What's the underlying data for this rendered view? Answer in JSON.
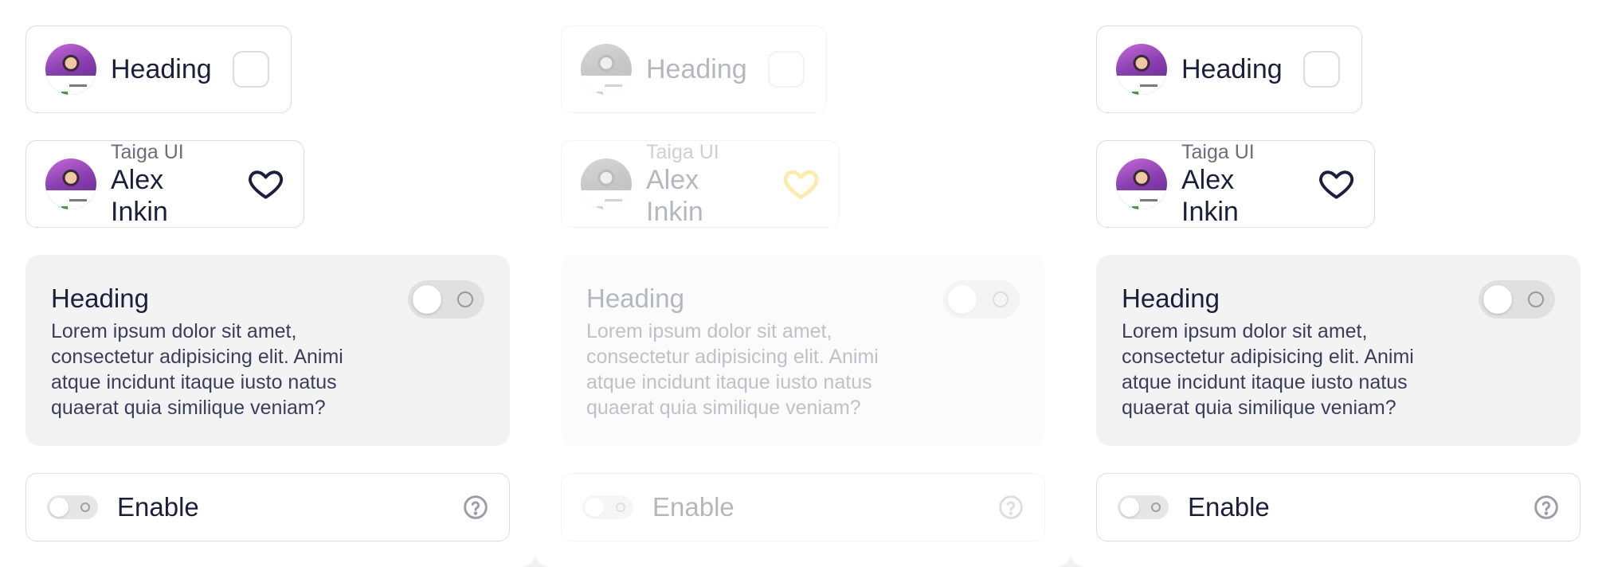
{
  "colors": {
    "text": "#1b1f3b",
    "subtext": "#6b6d7c",
    "border": "#dddddd",
    "card_bg": "#f3f3f3",
    "focus_heart": "#f5c400"
  },
  "panels": [
    {
      "state": "default",
      "cell1": {
        "heading": "Heading"
      },
      "cell2": {
        "sub": "Taiga UI",
        "name": "Alex Inkin",
        "heart_icon": "heart-icon"
      },
      "card": {
        "title": "Heading",
        "description": "Lorem ipsum dolor sit amet, consectetur adipisicing elit. Animi atque incidunt itaque iusto natus quaerat quia similique veniam?"
      },
      "enable": {
        "label": "Enable",
        "help_icon": "question-circle-icon"
      }
    },
    {
      "state": "disabled",
      "cell1": {
        "heading": "Heading"
      },
      "cell2": {
        "sub": "Taiga UI",
        "name": "Alex Inkin",
        "heart_icon": "heart-icon"
      },
      "card": {
        "title": "Heading",
        "description": "Lorem ipsum dolor sit amet, consectetur adipisicing elit. Animi atque incidunt itaque iusto natus quaerat quia similique veniam?"
      },
      "enable": {
        "label": "Enable",
        "help_icon": "question-circle-icon"
      }
    },
    {
      "state": "default",
      "cell1": {
        "heading": "Heading"
      },
      "cell2": {
        "sub": "Taiga UI",
        "name": "Alex Inkin",
        "heart_icon": "heart-icon"
      },
      "card": {
        "title": "Heading",
        "description": "Lorem ipsum dolor sit amet, consectetur adipisicing elit. Animi atque incidunt itaque iusto natus quaerat quia similique veniam?"
      },
      "enable": {
        "label": "Enable",
        "help_icon": "question-circle-icon"
      }
    }
  ]
}
